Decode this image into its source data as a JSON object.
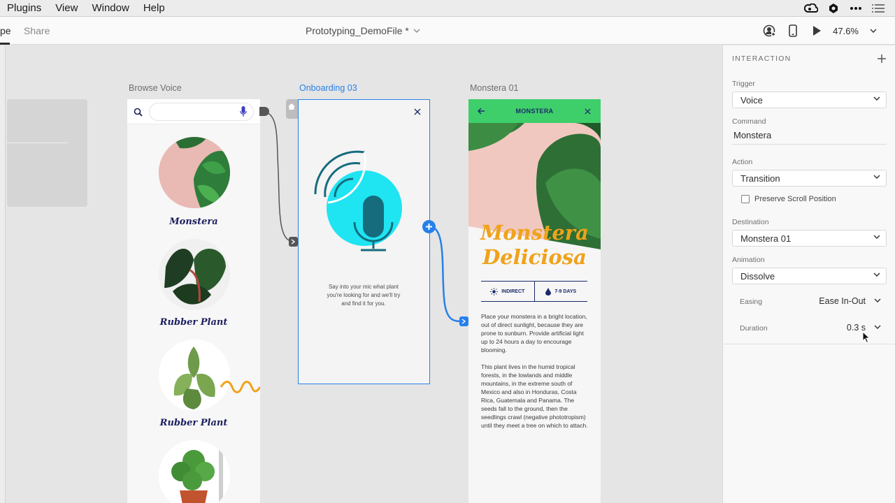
{
  "menubar": {
    "items": [
      "Plugins",
      "View",
      "Window",
      "Help"
    ],
    "tray_icons": [
      "creative-cloud-icon",
      "sync-icon",
      "more-icon",
      "list-icon"
    ]
  },
  "toolbar": {
    "modes": [
      "pe",
      "Share"
    ],
    "document_title": "Prototyping_DemoFile *",
    "zoom": "47.6%",
    "icons": [
      "user-icon",
      "mobile-preview-icon",
      "play-icon",
      "chevron-down-icon"
    ]
  },
  "canvas": {
    "artboards": {
      "browse": {
        "label": "Browse Voice",
        "plants": [
          "Monstera",
          "Rubber Plant",
          "Rubber Plant"
        ]
      },
      "onboarding": {
        "label": "Onboarding 03",
        "prompt": "Say into your mic what plant you're looking for and we'll try and find it for you."
      },
      "monstera": {
        "label": "Monstera 01",
        "header": "MONSTERA",
        "title_line1": "Monstera",
        "title_line2": "Deliciosa",
        "chip_light": "INDIRECT",
        "chip_water": "7-9 DAYS",
        "para1": "Place your monstera in a bright location, out of direct sunlight, because they are prone to sunburn. Provide artificial light up to 24 hours a day to encourage blooming.",
        "para2": "This plant lives in the humid tropical forests, in the lowlands and middle mountains, in the extreme south of Mexico and also in Honduras, Costa Rica, Guatemala and Panama. The seeds fall to the ground, then the seedlings crawl (negative phototropism) until they meet a tree on which to attach."
      }
    }
  },
  "panel": {
    "heading": "INTERACTION",
    "trigger_label": "Trigger",
    "trigger_value": "Voice",
    "command_label": "Command",
    "command_value": "Monstera",
    "action_label": "Action",
    "action_value": "Transition",
    "preserve_scroll_label": "Preserve Scroll Position",
    "preserve_scroll_checked": false,
    "destination_label": "Destination",
    "destination_value": "Monstera 01",
    "animation_label": "Animation",
    "animation_value": "Dissolve",
    "easing_label": "Easing",
    "easing_value": "Ease In-Out",
    "duration_label": "Duration",
    "duration_value": "0.3 s"
  },
  "colors": {
    "accent": "#2680eb",
    "plant_name": "#1b1f5f",
    "title_orange": "#f0a21a",
    "mic_cyan": "#1fe4f2",
    "mic_teal": "#166c7c"
  }
}
